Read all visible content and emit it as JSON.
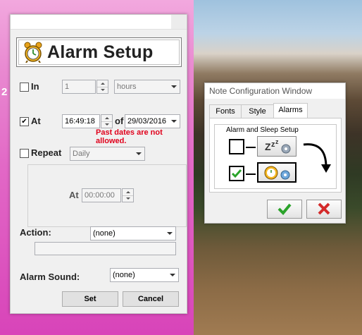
{
  "desktop": {
    "partial_text": "2"
  },
  "alarm_window": {
    "title": "Alarm Setup",
    "in_row": {
      "checked": false,
      "label": "In",
      "value": "1",
      "unit": "hours"
    },
    "at_row": {
      "checked": true,
      "label": "At",
      "time": "16:49:18",
      "of_label": "of",
      "date": "29/03/2016",
      "error": "Past dates are not allowed."
    },
    "repeat_row": {
      "checked": false,
      "label": "Repeat",
      "mode": "Daily",
      "at_label": "At",
      "at_time": "00:00:00"
    },
    "action": {
      "label": "Action:",
      "value": "(none)"
    },
    "alarm_sound": {
      "label": "Alarm Sound:",
      "value": "(none)"
    },
    "buttons": {
      "set": "Set",
      "cancel": "Cancel"
    }
  },
  "note_window": {
    "title": "Note Configuration Window",
    "tabs": [
      "Fonts",
      "Style",
      "Alarms"
    ],
    "active_tab": "Alarms",
    "group_label": "Alarm and Sleep Setup",
    "sleep_checked": false,
    "alarm_checked": true,
    "ok_icon": "green-checkmark-icon",
    "cancel_icon": "red-x-icon"
  },
  "colors": {
    "error": "#e0001b",
    "check_green": "#2aa32a",
    "cancel_red": "#d42a2a",
    "pink": "#e268c6"
  }
}
